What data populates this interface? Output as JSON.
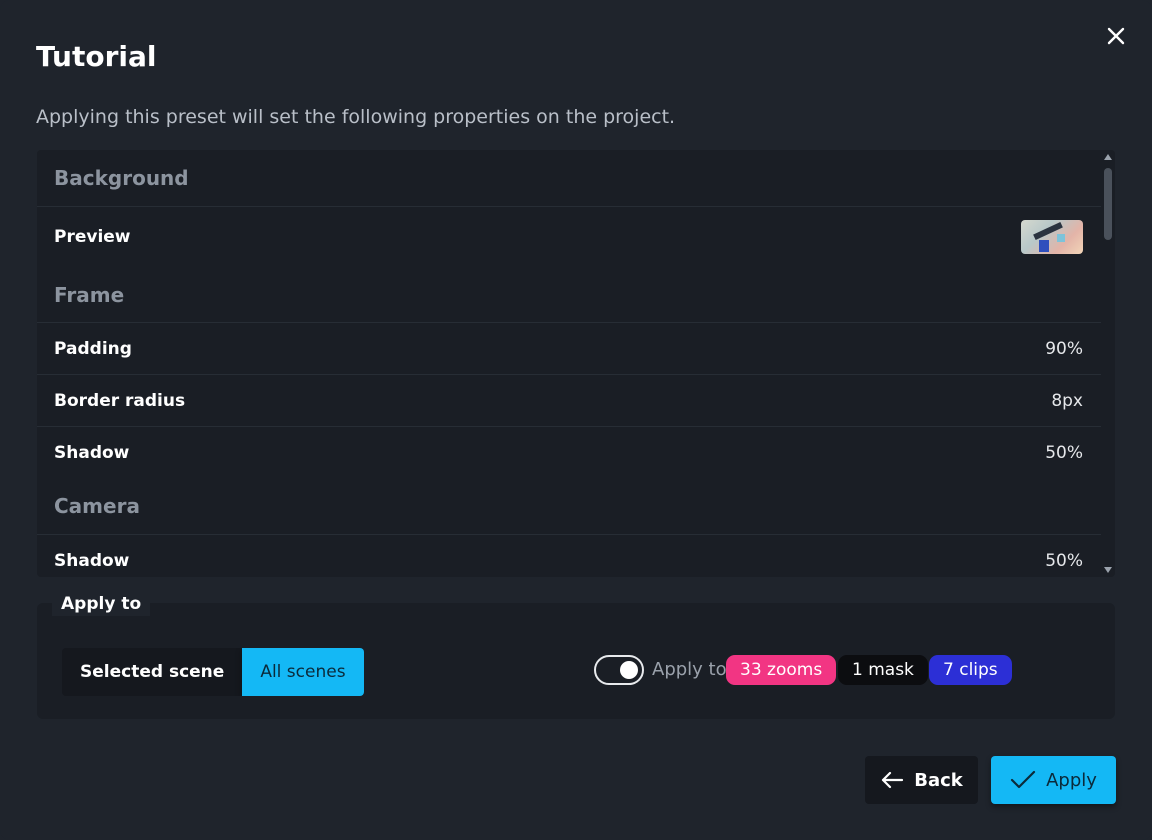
{
  "dialog": {
    "title": "Tutorial",
    "description": "Applying this preset will set the following properties on the project."
  },
  "properties": {
    "background_section": "Background",
    "preview_label": "Preview",
    "frame_section": "Frame",
    "padding_label": "Padding",
    "padding_value": "90%",
    "border_radius_label": "Border radius",
    "border_radius_value": "8px",
    "frame_shadow_label": "Shadow",
    "frame_shadow_value": "50%",
    "camera_section": "Camera",
    "camera_shadow_label": "Shadow",
    "camera_shadow_value": "50%"
  },
  "apply_to": {
    "label": "Apply to",
    "selected_scene": "Selected scene",
    "all_scenes": "All scenes",
    "active_option": "All scenes",
    "toggle_on": true,
    "toggle_text": "Apply to",
    "zooms": "33 zooms",
    "mask": "1 mask",
    "clips": "7 clips"
  },
  "footer": {
    "back_label": "Back",
    "apply_label": "Apply"
  },
  "colors": {
    "accent": "#14b8f5",
    "zooms_chip": "#f23583",
    "mask_chip": "#0c0d10",
    "clips_chip": "#2c2fd6"
  },
  "icons": [
    "close-icon",
    "arrow-left-icon",
    "check-icon",
    "scroll-up-icon",
    "scroll-down-icon"
  ]
}
